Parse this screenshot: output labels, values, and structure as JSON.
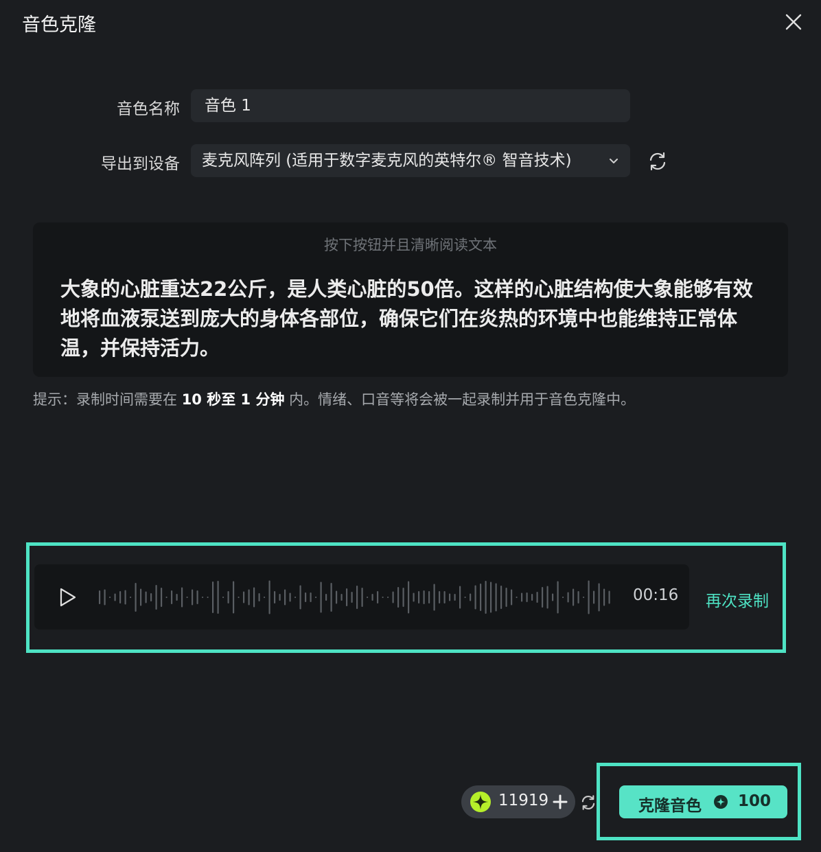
{
  "dialog": {
    "title": "音色克隆",
    "name_label": "音色名称",
    "name_value": "音色 1",
    "device_label": "导出到设备",
    "device_value": "麦克风阵列 (适用于数字麦克风的英特尔® 智音技术)"
  },
  "reading": {
    "hint": "按下按钮并且清晰阅读文本",
    "text": "大象的心脏重达22公斤，是人类心脏的50倍。这样的心脏结构使大象能够有效地将血液泵送到庞大的身体各部位，确保它们在炎热的环境中也能维持正常体温，并保持活力。"
  },
  "tip": {
    "prefix": "提示：录制时间需要在 ",
    "emphasis": "10 秒至 1 分钟",
    "suffix": " 内。情绪、口音等将会被一起录制并用于音色克隆中。"
  },
  "recording": {
    "duration": "00:16",
    "rerecord_label": "再次录制"
  },
  "credits": {
    "balance": "11919"
  },
  "clone": {
    "label": "克隆音色",
    "cost": "100"
  },
  "colors": {
    "accent": "#4ee3c4",
    "background": "#1b1d20",
    "panel": "#141618",
    "field": "#26292d"
  },
  "icons": {
    "close": "close-icon",
    "chevron": "chevron-down-icon",
    "refresh": "refresh-icon",
    "play": "play-icon",
    "gem": "credit-gem-icon",
    "plus": "plus-icon",
    "coin": "coin-icon"
  }
}
